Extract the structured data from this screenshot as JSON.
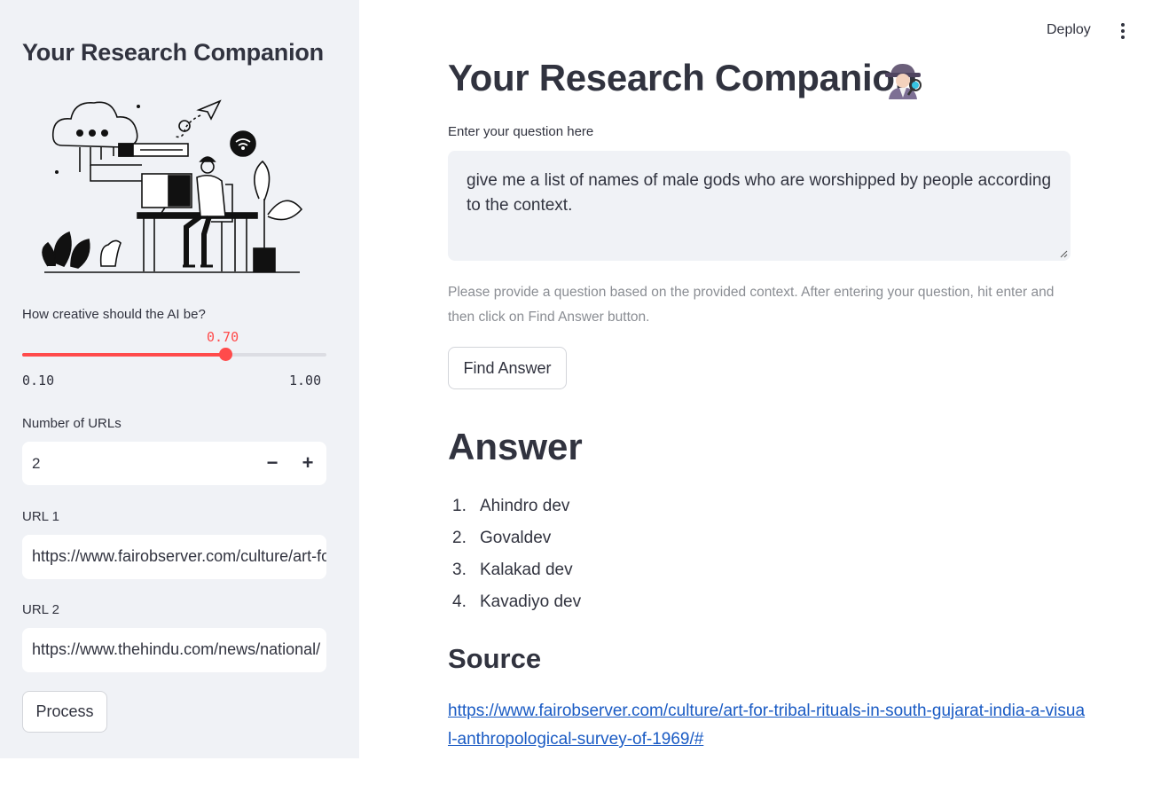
{
  "sidebar": {
    "title": "Your Research Companion",
    "creativity": {
      "label": "How creative should the AI be?",
      "value": "0.70",
      "min": "0.10",
      "max": "1.00",
      "fraction": 0.667
    },
    "num_urls": {
      "label": "Number of URLs",
      "value": "2",
      "decrement": "−",
      "increment": "+"
    },
    "urls": [
      {
        "label": "URL 1",
        "value": "https://www.fairobserver.com/culture/art-for-tribal-rituals-in-south-gujarat-india"
      },
      {
        "label": "URL 2",
        "value": "https://www.thehindu.com/news/national/"
      }
    ],
    "process_label": "Process"
  },
  "header": {
    "deploy_label": "Deploy",
    "menu_icon": "vertical-ellipsis-icon"
  },
  "main": {
    "title": "Your Research Companion",
    "title_icon": "detective-emoji-icon",
    "question_label": "Enter your question here",
    "question_value": "give me a list of names of male gods  who are worshipped by people according to the context.",
    "help_text": "Please provide a question based on the provided context. After entering your question, hit enter and then click on Find Answer button.",
    "find_answer_label": "Find Answer",
    "answer_heading": "Answer",
    "answers": [
      {
        "num": "1.",
        "text": "Ahindro dev"
      },
      {
        "num": "2.",
        "text": "Govaldev"
      },
      {
        "num": "3.",
        "text": "Kalakad dev"
      },
      {
        "num": "4.",
        "text": "Kavadiyo dev"
      }
    ],
    "source_heading": "Source",
    "source_link": "https://www.fairobserver.com/culture/art-for-tribal-rituals-in-south-gujarat-india-a-visual-anthropological-survey-of-1969/#"
  },
  "colors": {
    "accent": "#ff4b4b",
    "sidebar_bg": "#f0f2f6",
    "link": "#1a5bc4",
    "text": "#31333f"
  }
}
